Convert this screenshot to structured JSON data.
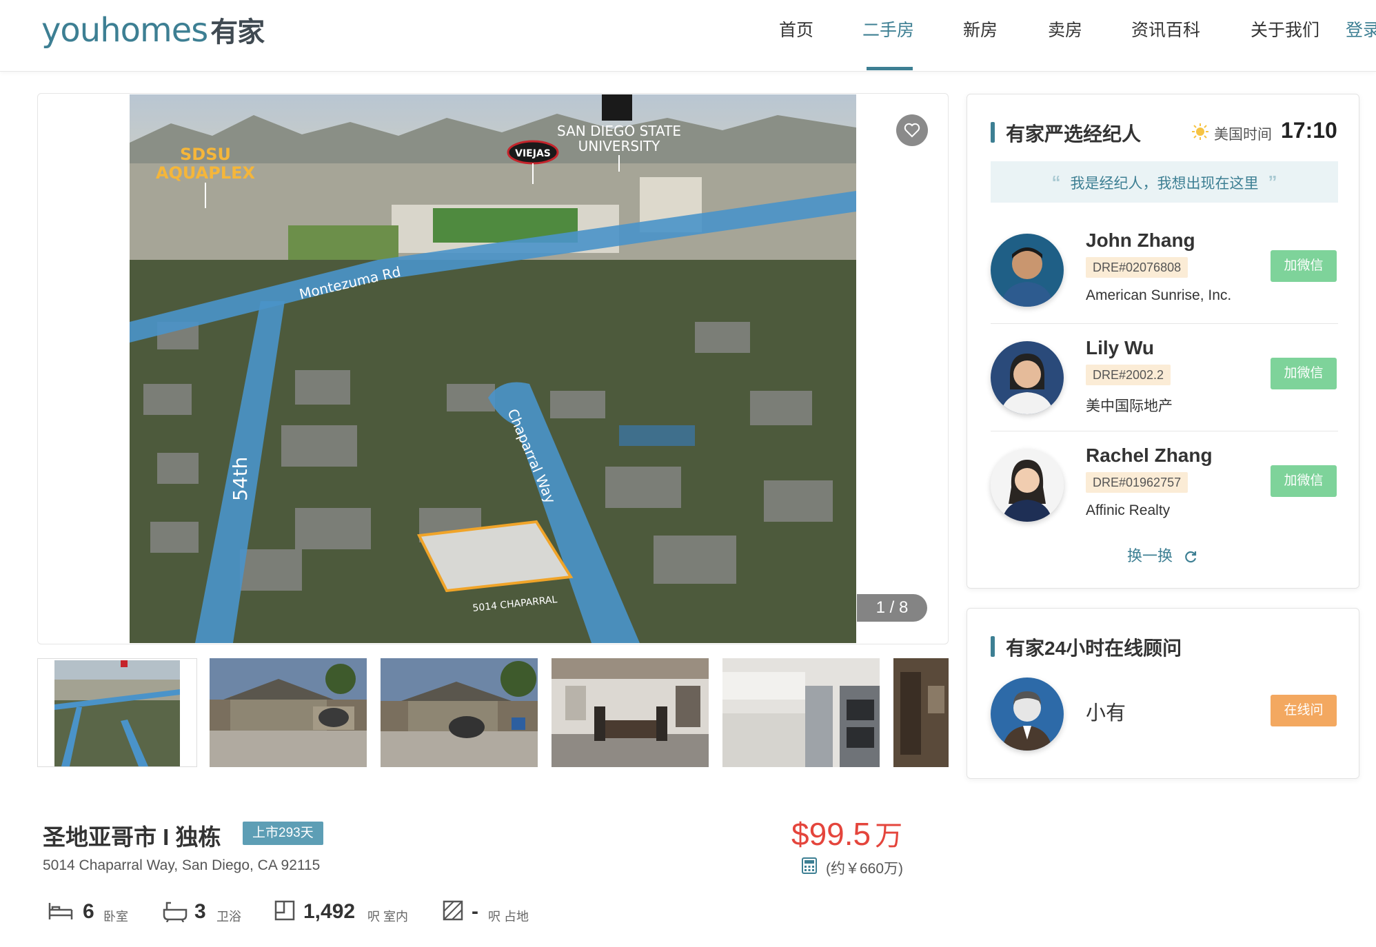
{
  "header": {
    "logo_text": "youhomes",
    "logo_cn": "有家",
    "nav": [
      {
        "label": "首页"
      },
      {
        "label": "二手房",
        "active": true
      },
      {
        "label": "新房"
      },
      {
        "label": "卖房"
      },
      {
        "label": "资讯百科"
      },
      {
        "label": "关于我们"
      }
    ],
    "login_label": "登录"
  },
  "gallery": {
    "counter": "1 / 8",
    "favorite_icon": "heart-icon",
    "main_photo_labels": {
      "aquaplex_line1": "SDSU",
      "aquaplex_line2": "AQUAPLEX",
      "viejas": "VIEJAS",
      "sdsu_line1": "SAN DIEGO STATE",
      "sdsu_line2": "UNIVERSITY",
      "montezuma": "Montezuma Rd",
      "street_54th": "54th",
      "chaparral": "Chaparral Way",
      "lot_label": "5014 CHAPARRAL"
    },
    "thumbnails": [
      "aerial",
      "house-front-dusk",
      "house-front-car",
      "dining-room",
      "kitchen",
      "hallway"
    ]
  },
  "listing": {
    "title": "圣地亚哥市 I 独栋",
    "listed_badge": "上市293天",
    "address": "5014 Chaparral Way, San Diego, CA 92115",
    "price": "$99.5",
    "price_unit": "万",
    "price_cny": "(约￥660万)",
    "specs": [
      {
        "icon": "bed-icon",
        "value": "6",
        "label": "卧室"
      },
      {
        "icon": "bathtub-icon",
        "value": "3",
        "label": "卫浴"
      },
      {
        "icon": "interior-area-icon",
        "value": "1,492",
        "label": "呎 室内"
      },
      {
        "icon": "lot-area-icon",
        "value": "-",
        "label": "呎 占地"
      }
    ]
  },
  "agents_panel": {
    "title": "有家严选经纪人",
    "time_label": "美国时间",
    "time": "17:10",
    "banner": "我是经纪人，我想出现在这里",
    "wechat_label": "加微信",
    "agents": [
      {
        "name": "John Zhang",
        "dre": "DRE#02076808",
        "company": "American Sunrise, Inc."
      },
      {
        "name": "Lily Wu",
        "dre": "DRE#2002.2",
        "company": "美中国际地产"
      },
      {
        "name": "Rachel Zhang",
        "dre": "DRE#01962757",
        "company": "Affinic Realty"
      }
    ],
    "swap_label": "换一换"
  },
  "advisor_panel": {
    "title": "有家24小时在线顾问",
    "name": "小有",
    "button": "在线问"
  },
  "colors": {
    "brand": "#3d7f93",
    "price": "#e4453c",
    "wechat": "#7ed39a",
    "online": "#f3a860",
    "badge": "#5d9eb5"
  }
}
